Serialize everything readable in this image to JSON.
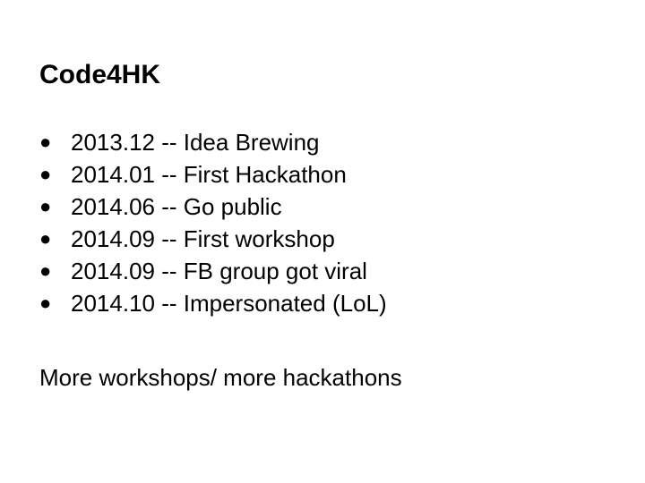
{
  "slide": {
    "title": "Code4HK",
    "bullet_glyph": "●",
    "bullets": [
      "2013.12 -- Idea Brewing",
      "2014.01 -- First Hackathon",
      "2014.06 -- Go public",
      "2014.09 -- First workshop",
      "2014.09 -- FB group got viral",
      "2014.10 -- Impersonated (LoL)"
    ],
    "footer": "More workshops/ more hackathons"
  }
}
